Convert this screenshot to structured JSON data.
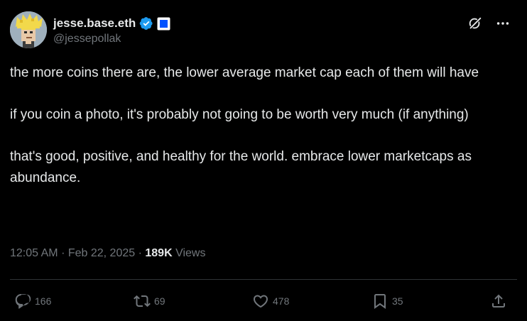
{
  "author": {
    "display_name": "jesse.base.eth",
    "handle": "@jessepollak"
  },
  "colors": {
    "background": "#000000",
    "text_primary": "#e7e9ea",
    "text_secondary": "#71767b",
    "verified_blue": "#1d9bf0",
    "affiliate_blue": "#0052ff",
    "divider": "#2f3336"
  },
  "icons": {
    "verified": "verified-badge-icon",
    "affiliate": "base-affiliate-icon",
    "grok": "grok-icon",
    "more": "more-options-icon",
    "reply": "reply-icon",
    "retweet": "retweet-icon",
    "like": "like-icon",
    "bookmark": "bookmark-icon",
    "share": "share-icon"
  },
  "tweet": {
    "paragraphs": [
      "the more coins there are, the lower average market cap each of them will have",
      "if you coin a photo, it's probably not going to be worth very much (if anything)",
      "that's good, positive, and healthy for the world. embrace lower marketcaps as abundance."
    ],
    "time": "12:05 AM",
    "separator": "·",
    "date": "Feb 22, 2025",
    "views_count": "189K",
    "views_label": "Views"
  },
  "actions": {
    "replies": "166",
    "retweets": "69",
    "likes": "478",
    "bookmarks": "35"
  }
}
